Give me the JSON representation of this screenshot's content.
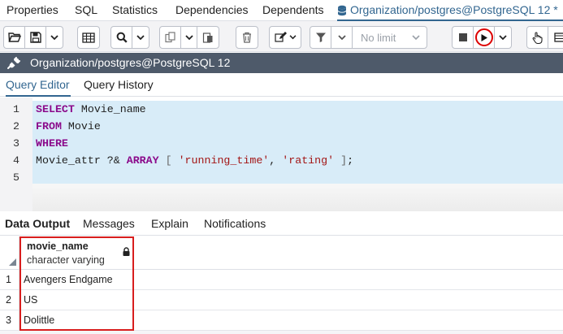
{
  "top_tabs": [
    {
      "label": "Properties"
    },
    {
      "label": "SQL"
    },
    {
      "label": "Statistics"
    },
    {
      "label": "Dependencies"
    },
    {
      "label": "Dependents"
    },
    {
      "label": "Organization/postgres@PostgreSQL 12 *"
    }
  ],
  "toolbar": {
    "limit_label": "No limit"
  },
  "connection": {
    "label": "Organization/postgres@PostgreSQL 12"
  },
  "editor_tabs": [
    {
      "label": "Query Editor"
    },
    {
      "label": "Query History"
    }
  ],
  "editor": {
    "line_numbers": [
      "1",
      "2",
      "3",
      "4",
      "5"
    ],
    "lines": [
      [
        {
          "t": "kw",
          "s": "SELECT"
        },
        {
          "t": "plain",
          "s": " Movie_name"
        }
      ],
      [
        {
          "t": "kw",
          "s": "FROM"
        },
        {
          "t": "plain",
          "s": " Movie"
        }
      ],
      [
        {
          "t": "kw",
          "s": "WHERE"
        }
      ],
      [
        {
          "t": "plain",
          "s": "Movie_attr ?& "
        },
        {
          "t": "kw",
          "s": "ARRAY"
        },
        {
          "t": "punct",
          "s": " [ "
        },
        {
          "t": "str",
          "s": "'running_time'"
        },
        {
          "t": "plain",
          "s": ", "
        },
        {
          "t": "str",
          "s": "'rating'"
        },
        {
          "t": "punct",
          "s": " ]"
        },
        {
          "t": "plain",
          "s": ";"
        }
      ],
      []
    ]
  },
  "output_tabs": [
    {
      "label": "Data Output"
    },
    {
      "label": "Messages"
    },
    {
      "label": "Explain"
    },
    {
      "label": "Notifications"
    }
  ],
  "result": {
    "column": {
      "name": "movie_name",
      "type": "character varying"
    },
    "rows": [
      {
        "num": "1",
        "value": "Avengers Endgame"
      },
      {
        "num": "2",
        "value": "US"
      },
      {
        "num": "3",
        "value": "Dolittle"
      }
    ]
  },
  "colors": {
    "accent": "#326690",
    "keyword": "#8b0a8b",
    "string": "#a31515",
    "connbar": "#4e5a6a",
    "highlight_border": "#d81e1e"
  }
}
